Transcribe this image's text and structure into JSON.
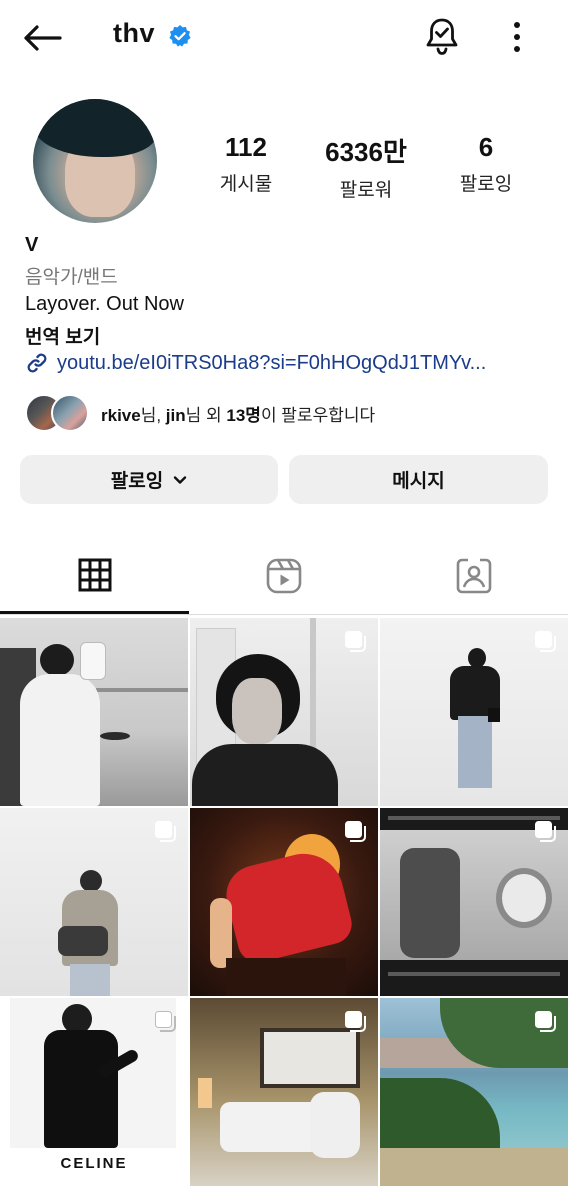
{
  "header": {
    "username": "thv",
    "icons": [
      "back-arrow-icon",
      "verified-badge-icon",
      "notification-bell-check-icon",
      "more-vertical-icon"
    ]
  },
  "profile": {
    "stats": [
      {
        "value": "112",
        "label": "게시물"
      },
      {
        "value": "6336만",
        "label": "팔로워"
      },
      {
        "value": "6",
        "label": "팔로잉"
      }
    ],
    "name": "V",
    "category": "음악가/밴드",
    "bio": "Layover. Out Now",
    "translate_label": "번역 보기",
    "link": "youtu.be/eI0iTRS0Ha8?si=F0hHOgQdJ1TMYv...",
    "followed_by": {
      "user1": "rkive",
      "suffix1": "님, ",
      "user2": "jin",
      "suffix2": "님 외 ",
      "count": "13명",
      "tail": "이 팔로우합니다"
    }
  },
  "actions": {
    "follow_label": "팔로잉",
    "message_label": "메시지"
  },
  "tabs": [
    "grid-icon",
    "reels-icon",
    "tagged-icon"
  ],
  "grid": {
    "posts": [
      {
        "type": "photo"
      },
      {
        "type": "multi"
      },
      {
        "type": "multi"
      },
      {
        "type": "multi"
      },
      {
        "type": "multi"
      },
      {
        "type": "multi"
      },
      {
        "type": "multi",
        "caption": "CELINE"
      },
      {
        "type": "multi"
      },
      {
        "type": "multi"
      }
    ]
  },
  "colors": {
    "accent_link": "#1a3c8a",
    "verified": "#1c8ff0",
    "button_bg": "#efefef"
  }
}
